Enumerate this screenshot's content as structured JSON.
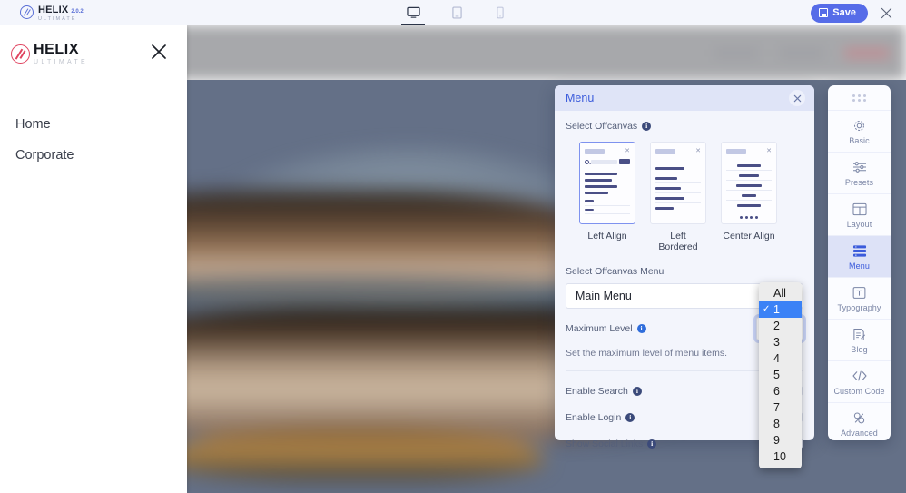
{
  "topbar": {
    "brand": {
      "name": "HELIX",
      "sub": "ULTIMATE",
      "version": "2.0.2"
    },
    "devices": [
      {
        "name": "desktop",
        "label": "Desktop",
        "active": true
      },
      {
        "name": "tablet",
        "label": "Tablet",
        "active": false
      },
      {
        "name": "mobile",
        "label": "Mobile",
        "active": false
      }
    ],
    "save_label": "Save",
    "close_label": "✕"
  },
  "offcanvas": {
    "brand": {
      "name": "HELIX",
      "sub": "ULTIMATE"
    },
    "close_label": "✕",
    "nav": [
      {
        "label": "Home"
      },
      {
        "label": "Corporate"
      }
    ]
  },
  "panel": {
    "title": "Menu",
    "close_label": "✕",
    "select_offcanvas_label": "Select Offcanvas",
    "cards": [
      {
        "label": "Left Align",
        "selected": true
      },
      {
        "label": "Left Bordered",
        "selected": false
      },
      {
        "label": "Center Align",
        "selected": false
      }
    ],
    "select_menu_label": "Select Offcanvas Menu",
    "selected_menu": "Main Menu",
    "max_level_label": "Maximum Level",
    "max_level_value": "1",
    "max_level_helper": "Set the maximum level of menu items.",
    "toggles": [
      {
        "label": "Enable Search",
        "on": false
      },
      {
        "label": "Enable Login",
        "on": false
      },
      {
        "label": "Show Social Links",
        "on": false
      }
    ],
    "info_glyph": "i"
  },
  "dropdown": {
    "options": [
      "All",
      "1",
      "2",
      "3",
      "4",
      "5",
      "6",
      "7",
      "8",
      "9",
      "10"
    ],
    "selected": "1"
  },
  "sidebar": {
    "items": [
      {
        "label": "Basic",
        "icon": "gear-icon",
        "active": false
      },
      {
        "label": "Presets",
        "icon": "sliders-icon",
        "active": false
      },
      {
        "label": "Layout",
        "icon": "layout-icon",
        "active": false
      },
      {
        "label": "Menu",
        "icon": "menu-list-icon",
        "active": true
      },
      {
        "label": "Typography",
        "icon": "typography-icon",
        "active": false
      },
      {
        "label": "Blog",
        "icon": "blog-icon",
        "active": false
      },
      {
        "label": "Custom Code",
        "icon": "code-icon",
        "active": false
      },
      {
        "label": "Advanced",
        "icon": "advanced-icon",
        "active": false
      }
    ]
  },
  "colors": {
    "accent": "#3b5bdb",
    "save_button": "#566ce8",
    "panel_bg": "#f3f5fc",
    "panel_header": "#dfe4f7",
    "sidebar_active": "#dde2f7",
    "dropdown_selected": "#3b82f6",
    "logo_ring": "#e0435f",
    "site_hero": "#647087"
  }
}
